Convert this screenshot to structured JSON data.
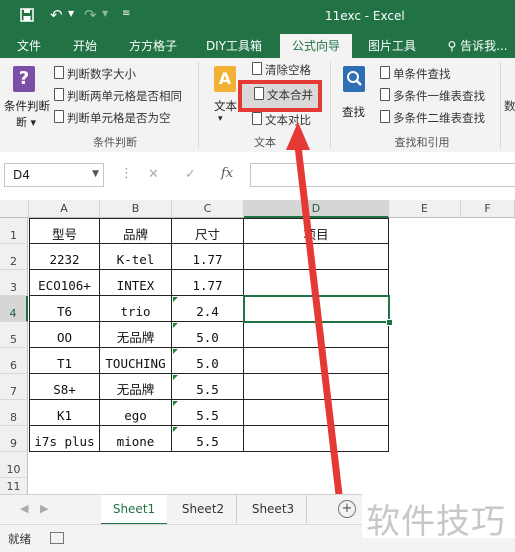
{
  "titlebar": {
    "doc_title": "11exc - Excel"
  },
  "tabs": [
    {
      "label": "文件",
      "active": false
    },
    {
      "label": "开始",
      "active": false
    },
    {
      "label": "方方格子",
      "active": false
    },
    {
      "label": "DIY工具箱",
      "active": false
    },
    {
      "label": "公式向导",
      "active": true
    },
    {
      "label": "图片工具",
      "active": false
    },
    {
      "label": "告诉我...",
      "active": false
    }
  ],
  "ribbon": {
    "group_condition": {
      "big_button": "条件判断",
      "items": [
        "判断数字大小",
        "判断两单元格是否相同",
        "判断单元格是否为空"
      ],
      "group_label": "条件判断"
    },
    "group_text": {
      "big_button": "文本",
      "items": [
        "清除空格",
        "文本合并",
        "文本对比"
      ],
      "group_label": "文本"
    },
    "group_lookup": {
      "big_button": "查找",
      "items": [
        "单条件查找",
        "多条件一维表查找",
        "多条件二维表查找"
      ],
      "group_label": "查找和引用"
    },
    "overflow_label": "数"
  },
  "formula_bar": {
    "name_box": "D4",
    "fx": "fx",
    "cancel": "✕",
    "enter": "✓"
  },
  "columns": [
    "A",
    "B",
    "C",
    "D",
    "E",
    "F"
  ],
  "rows": [
    "1",
    "2",
    "3",
    "4",
    "5",
    "6",
    "7",
    "8",
    "9",
    "10",
    "11"
  ],
  "table": [
    [
      "型号",
      "品牌",
      "尺寸",
      "项目"
    ],
    [
      "2232",
      "K-tel",
      "1.77",
      ""
    ],
    [
      "ECO106+",
      "INTEX",
      "1.77",
      ""
    ],
    [
      "T6",
      "trio",
      "2.4",
      ""
    ],
    [
      "OO",
      "无品牌",
      "5.0",
      ""
    ],
    [
      "T1",
      "TOUCHING",
      "5.0",
      ""
    ],
    [
      "S8+",
      "无品牌",
      "5.5",
      ""
    ],
    [
      "K1",
      "ego",
      "5.5",
      ""
    ],
    [
      "i7s plus",
      "mione",
      "5.5",
      ""
    ]
  ],
  "sheets": [
    {
      "label": "Sheet1",
      "active": true
    },
    {
      "label": "Sheet2",
      "active": false
    },
    {
      "label": "Sheet3",
      "active": false
    }
  ],
  "status": {
    "ready": "就绪"
  },
  "watermark": "软件技巧",
  "colors": {
    "excel_green": "#217346",
    "highlight_red": "#e53935",
    "error_triangle": "#1b8a3a"
  }
}
